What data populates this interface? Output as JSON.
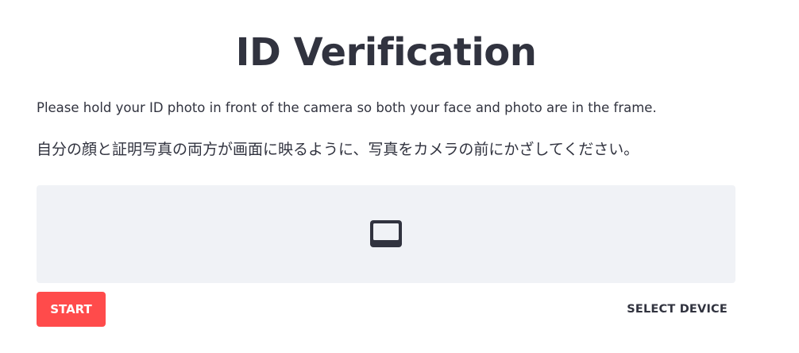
{
  "page": {
    "title": "ID Verification",
    "instruction_en": "Please hold your ID photo in front of the camera so both your face and photo are in the frame.",
    "instruction_ja": "自分の顔と証明写真の両方が画面に映るように、写真をカメラの前にかざしてください。"
  },
  "camera": {
    "icon": "video-off-icon"
  },
  "controls": {
    "start_label": "START",
    "select_device_label": "SELECT DEVICE"
  },
  "colors": {
    "text": "#31333f",
    "accent": "#ff4b4b",
    "preview_bg": "#f0f2f6"
  }
}
